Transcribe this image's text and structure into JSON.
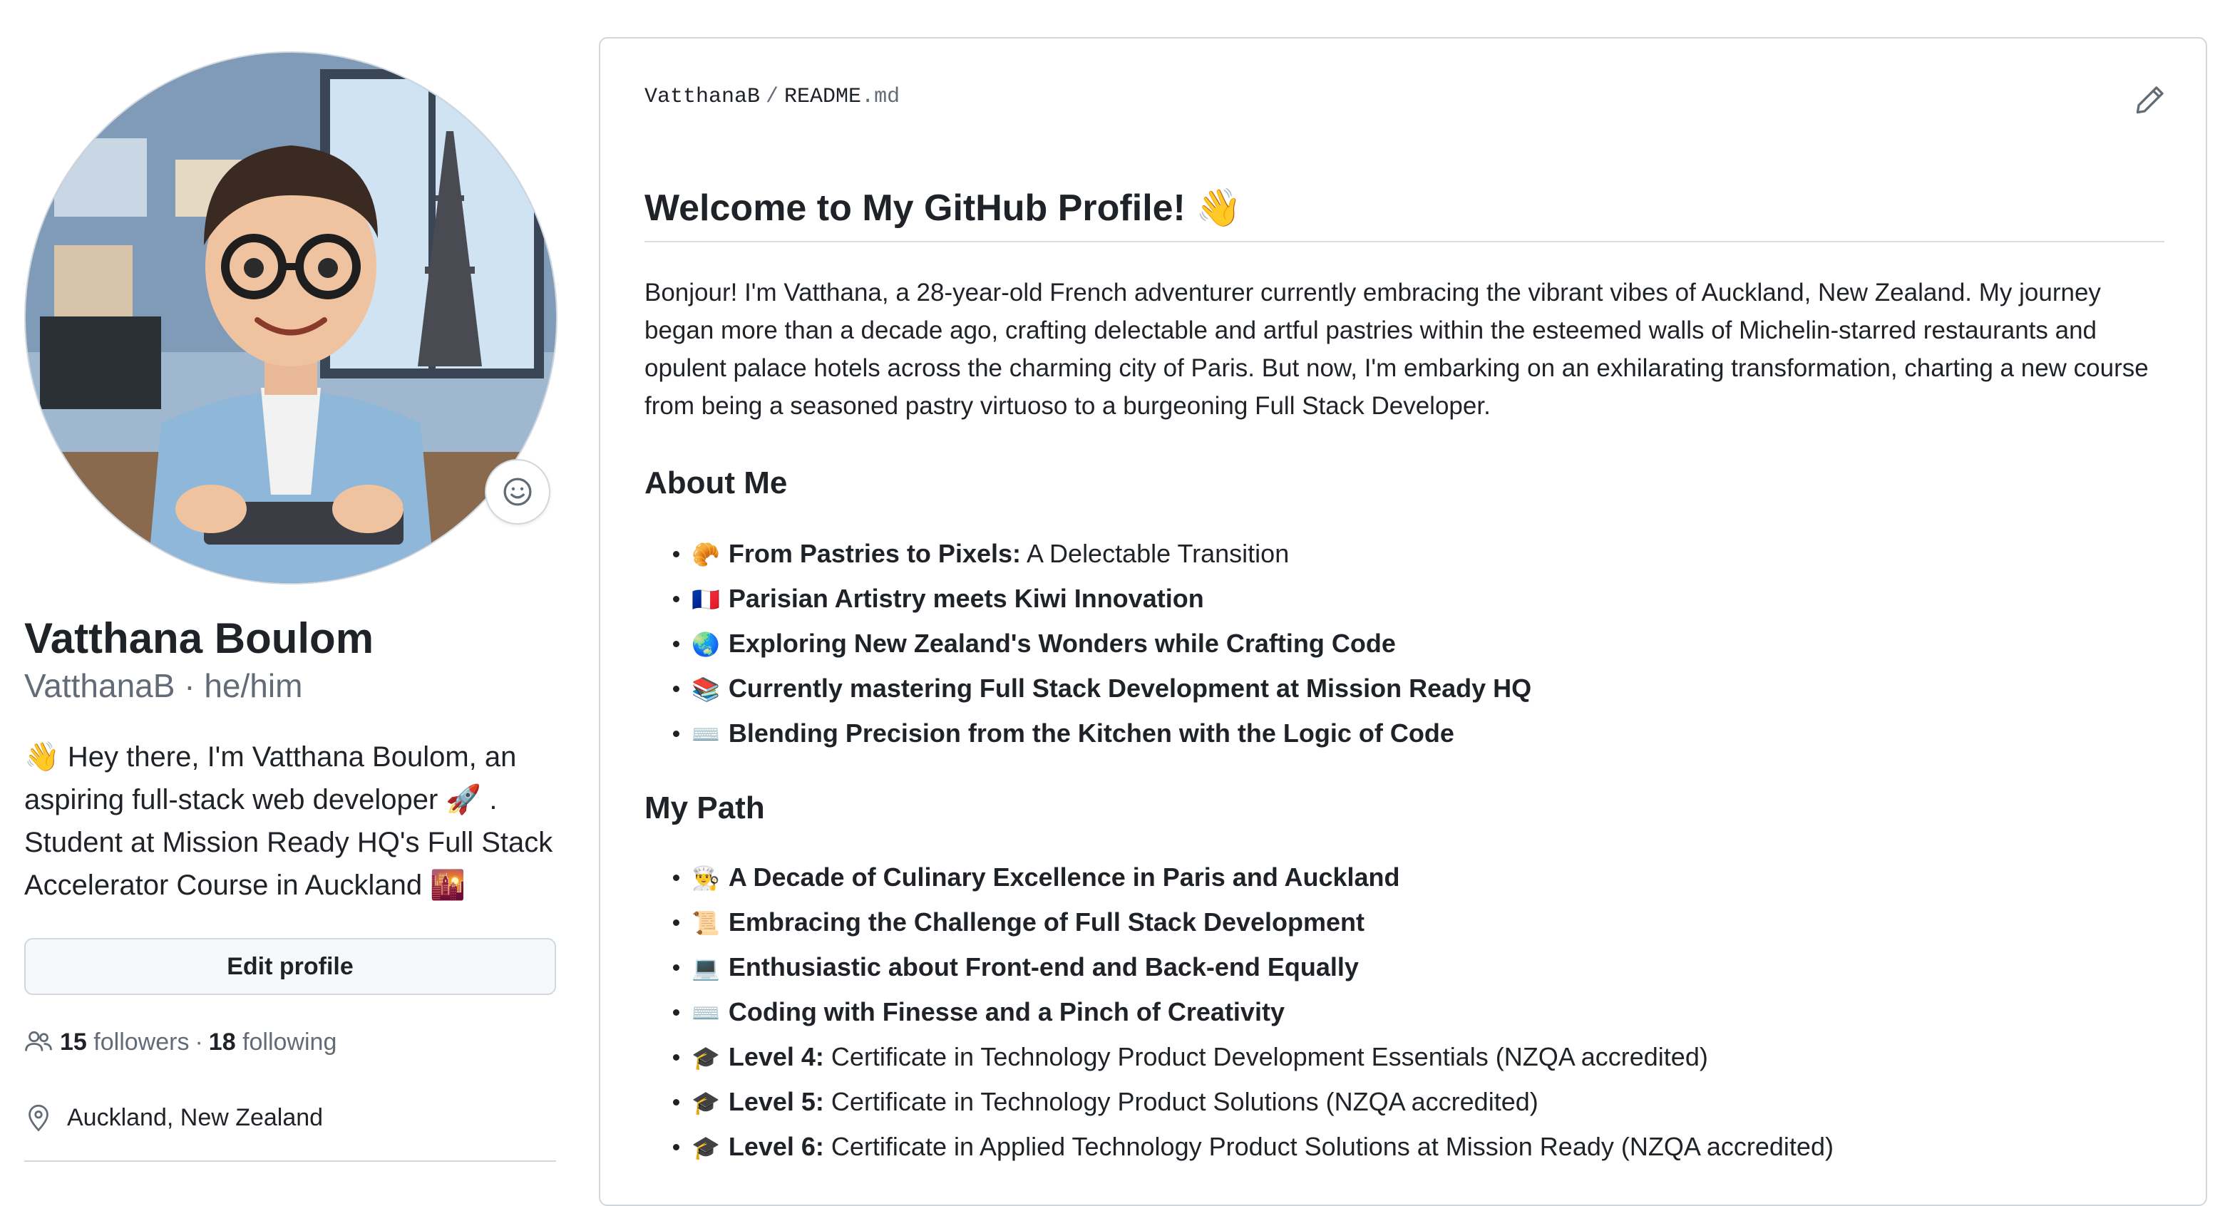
{
  "profile": {
    "full_name": "Vatthana Boulom",
    "username": "VatthanaB",
    "separator": "·",
    "pronouns": "he/him",
    "bio": "👋 Hey there, I'm Vatthana Boulom, an aspiring full-stack web developer 🚀 . Student at Mission Ready HQ's Full Stack Accelerator Course in Auckland 🌇",
    "edit_label": "Edit profile",
    "followers_count": "15",
    "followers_label": "followers",
    "dot": "·",
    "following_count": "18",
    "following_label": "following",
    "location": "Auckland, New Zealand",
    "avatar_description_icon": "avatar-cartoon-developer"
  },
  "readme": {
    "owner": "VatthanaB",
    "slash": "/",
    "file_base": "README",
    "file_ext": ".md",
    "title": "Welcome to My GitHub Profile! 👋",
    "intro": "Bonjour! I'm Vatthana, a 28-year-old French adventurer currently embracing the vibrant vibes of Auckland, New Zealand. My journey began more than a decade ago, crafting delectable and artful pastries within the esteemed walls of Michelin-starred restaurants and opulent palace hotels across the charming city of Paris. But now, I'm embarking on an exhilarating transformation, charting a new course from being a seasoned pastry virtuoso to a burgeoning Full Stack Developer.",
    "about_heading": "About Me",
    "about_items": [
      {
        "emoji": "🥐",
        "strong": "From Pastries to Pixels:",
        "rest": " A Delectable Transition"
      },
      {
        "emoji": "🇫🇷",
        "strong": "Parisian Artistry meets Kiwi Innovation",
        "rest": ""
      },
      {
        "emoji": "🌏",
        "strong": "Exploring New Zealand's Wonders while Crafting Code",
        "rest": ""
      },
      {
        "emoji": "📚",
        "strong": "Currently mastering Full Stack Development at Mission Ready HQ",
        "rest": ""
      },
      {
        "emoji": "⌨️",
        "strong": "Blending Precision from the Kitchen with the Logic of Code",
        "rest": ""
      }
    ],
    "path_heading": "My Path",
    "path_items": [
      {
        "emoji": "👨‍🍳",
        "strong": "A Decade of Culinary Excellence in Paris and Auckland",
        "rest": ""
      },
      {
        "emoji": "📜",
        "strong": "Embracing the Challenge of Full Stack Development",
        "rest": ""
      },
      {
        "emoji": "💻",
        "strong": "Enthusiastic about Front-end and Back-end Equally",
        "rest": ""
      },
      {
        "emoji": "⌨️",
        "strong": "Coding with Finesse and a Pinch of Creativity",
        "rest": ""
      },
      {
        "emoji": "🎓",
        "strong": "Level 4:",
        "rest": " Certificate in Technology Product Development Essentials (NZQA accredited)"
      },
      {
        "emoji": "🎓",
        "strong": "Level 5:",
        "rest": " Certificate in Technology Product Solutions (NZQA accredited)"
      },
      {
        "emoji": "🎓",
        "strong": "Level 6:",
        "rest": " Certificate in Applied Technology Product Solutions at Mission Ready (NZQA accredited)"
      }
    ]
  },
  "icons": {
    "status": "smiley-icon",
    "edit": "pencil-icon",
    "followers": "people-icon",
    "location": "location-pin-icon"
  },
  "colors": {
    "text": "#1f2328",
    "muted": "#636c76",
    "border": "#d0d7de",
    "button_bg": "#f6f8fa"
  }
}
